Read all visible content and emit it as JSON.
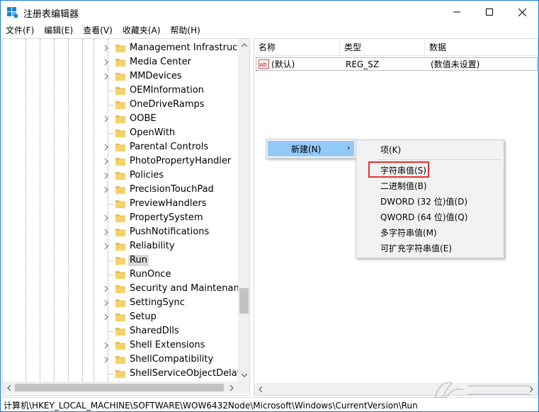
{
  "window": {
    "title": "注册表编辑器",
    "minimize_glyph": "—",
    "maximize_glyph": "☐",
    "close_glyph": "✕"
  },
  "menu": [
    "文件(F)",
    "编辑(E)",
    "查看(V)",
    "收藏夹(A)",
    "帮助(H)"
  ],
  "tree": {
    "items": [
      {
        "label": "Management Infrastructure",
        "expandable": true
      },
      {
        "label": "Media Center",
        "expandable": true
      },
      {
        "label": "MMDevices",
        "expandable": true
      },
      {
        "label": "OEMInformation",
        "expandable": false
      },
      {
        "label": "OneDriveRamps",
        "expandable": false
      },
      {
        "label": "OOBE",
        "expandable": true
      },
      {
        "label": "OpenWith",
        "expandable": false
      },
      {
        "label": "Parental Controls",
        "expandable": true
      },
      {
        "label": "PhotoPropertyHandler",
        "expandable": true
      },
      {
        "label": "Policies",
        "expandable": true
      },
      {
        "label": "PrecisionTouchPad",
        "expandable": true
      },
      {
        "label": "PreviewHandlers",
        "expandable": false
      },
      {
        "label": "PropertySystem",
        "expandable": true
      },
      {
        "label": "PushNotifications",
        "expandable": true
      },
      {
        "label": "Reliability",
        "expandable": true
      },
      {
        "label": "Run",
        "expandable": false,
        "selected": true
      },
      {
        "label": "RunOnce",
        "expandable": false
      },
      {
        "label": "Security and Maintenance",
        "expandable": true
      },
      {
        "label": "SettingSync",
        "expandable": true
      },
      {
        "label": "Setup",
        "expandable": true
      },
      {
        "label": "SharedDlls",
        "expandable": false
      },
      {
        "label": "Shell Extensions",
        "expandable": true
      },
      {
        "label": "ShellCompatibility",
        "expandable": true
      },
      {
        "label": "ShellServiceObjectDelayLoad",
        "expandable": false
      }
    ]
  },
  "values": {
    "columns": {
      "name": "名称",
      "type": "类型",
      "data": "数据"
    },
    "rows": [
      {
        "icon": "ab",
        "name": "(默认)",
        "type": "REG_SZ",
        "data": "(数值未设置)"
      }
    ]
  },
  "context_menu": {
    "new_label": "新建(N)",
    "submenu_arrow": "›",
    "submenu": [
      "项(K)",
      "字符串值(S)",
      "二进制值(B)",
      "DWORD (32 位)值(D)",
      "QWORD (64 位)值(Q)",
      "多字符串值(M)",
      "可扩充字符串值(E)"
    ],
    "highlight_color": "#e8302a",
    "hover_color": "#91c9f7"
  },
  "status": {
    "path": "计算机\\HKEY_LOCAL_MACHINE\\SOFTWARE\\WOW6432Node\\Microsoft\\Windows\\CurrentVersion\\Run"
  },
  "colors": {
    "accent": "#1e7dd7",
    "folder": "#f5d36b",
    "selection": "#d9d9d9"
  }
}
